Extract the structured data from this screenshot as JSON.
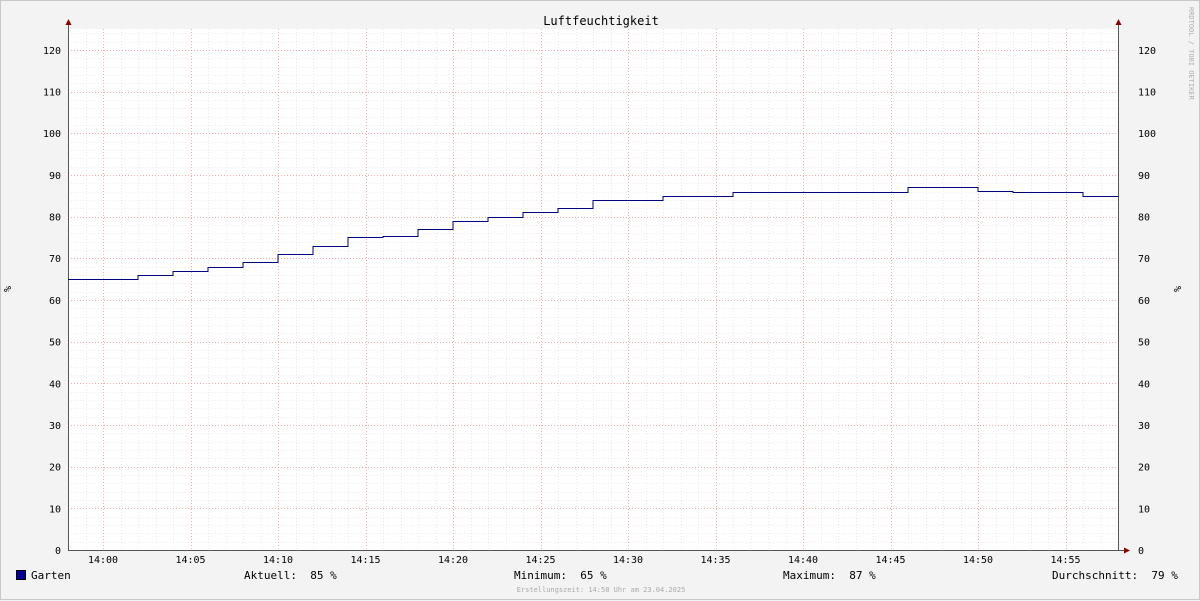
{
  "chart_data": {
    "type": "line",
    "step": true,
    "title": "Luftfeuchtigkeit",
    "ylabel": "%",
    "ylabel_right": "%",
    "xlabel": "",
    "ylim": [
      0,
      125
    ],
    "yticks": [
      0,
      10,
      20,
      30,
      40,
      50,
      60,
      70,
      80,
      90,
      100,
      110,
      120
    ],
    "xlim": [
      "13:58",
      "14:58"
    ],
    "xticks": [
      "14:00",
      "14:05",
      "14:10",
      "14:15",
      "14:20",
      "14:25",
      "14:30",
      "14:35",
      "14:40",
      "14:45",
      "14:50",
      "14:55"
    ],
    "grid": true,
    "series": [
      {
        "name": "Garten",
        "color": "#000080",
        "points": [
          [
            "13:58",
            65
          ],
          [
            "14:02",
            66
          ],
          [
            "14:04",
            67
          ],
          [
            "14:06",
            68
          ],
          [
            "14:08",
            69
          ],
          [
            "14:10",
            71
          ],
          [
            "14:12",
            73
          ],
          [
            "14:14",
            75
          ],
          [
            "14:16",
            75.3
          ],
          [
            "14:18",
            77
          ],
          [
            "14:20",
            79
          ],
          [
            "14:22",
            80
          ],
          [
            "14:24",
            81
          ],
          [
            "14:26",
            82
          ],
          [
            "14:28",
            84
          ],
          [
            "14:32",
            85
          ],
          [
            "14:36",
            86
          ],
          [
            "14:46",
            87
          ],
          [
            "14:50",
            86.2
          ],
          [
            "14:52",
            86
          ],
          [
            "14:56",
            85
          ],
          [
            "14:58",
            85
          ]
        ]
      }
    ]
  },
  "legend": {
    "label": "Garten",
    "color": "#000099",
    "current": "Aktuell:  85 %",
    "minimum": "Minimum:  65 %",
    "maximum": "Maximum:  87 %",
    "average": "Durchschnitt:  79 %"
  },
  "footer": "Erstellungszeit: 14:58 Uhr am 23.04.2025",
  "watermark": "RRDTOOL / TOBI OETIKER"
}
